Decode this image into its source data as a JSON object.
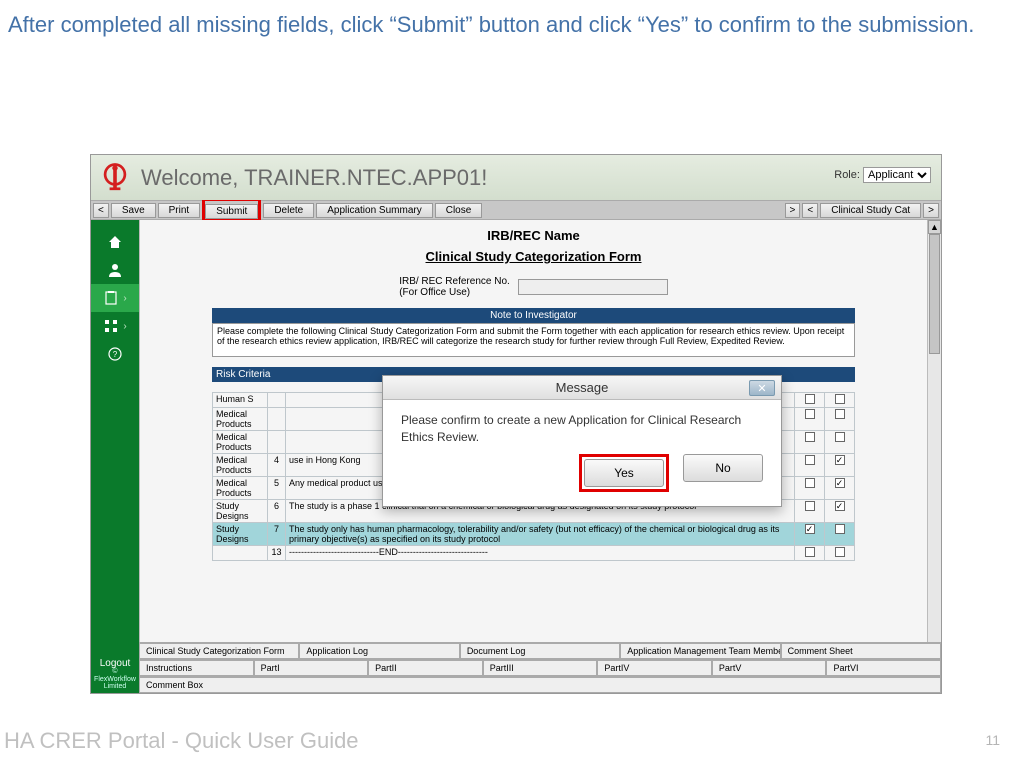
{
  "slide": {
    "title": "After completed all missing fields, click “Submit” button and click “Yes” to confirm to the submission.",
    "footer_left": "HA CRER Portal - Quick User Guide",
    "page_number": "11"
  },
  "header": {
    "welcome": "Welcome, TRAINER.NTEC.APP01!",
    "role_label": "Role:",
    "role_value": "Applicant"
  },
  "toolbar": {
    "nav_prev": "<",
    "save": "Save",
    "print": "Print",
    "submit": "Submit",
    "delete": "Delete",
    "app_summary": "Application Summary",
    "close": "Close",
    "nav_next": ">",
    "breadcrumb": "Clinical Study Cat",
    "breadcrumb_prev": "<",
    "breadcrumb_next": ">"
  },
  "sidebar": {
    "logout": "Logout",
    "copyright": "© FlexWorkflow Limited"
  },
  "form": {
    "heading": "IRB/REC Name",
    "subhead": "Clinical Study Categorization Form",
    "refno_label": "IRB/ REC Reference No.\n(For Office Use)",
    "note_bar": "Note to Investigator",
    "note_text": "Please complete the following Clinical Study Categorization Form and submit the Form together with each application for research ethics review.  Upon receipt of the research ethics review application, IRB/REC will categorize the research study for further review through Full Review, Expedited Review.",
    "risk_header": "Risk Criteria"
  },
  "risk_rows": [
    {
      "cat": "Human S",
      "num": "",
      "desc": "",
      "c1": "",
      "c2": ""
    },
    {
      "cat": "Medical Products",
      "num": "",
      "desc": "",
      "c1": "",
      "c2": ""
    },
    {
      "cat": "Medical Products",
      "num": "",
      "desc": "",
      "c1": "",
      "c2": ""
    },
    {
      "cat": "Medical Products",
      "num": "4",
      "desc": "use in Hong Kong",
      "c1": "",
      "c2": "✓"
    },
    {
      "cat": "Medical Products",
      "num": "5",
      "desc": "Any medical product used is a chemical or biological drug that is to be tested in humans for the first time",
      "c1": "",
      "c2": "✓"
    },
    {
      "cat": "Study Designs",
      "num": "6",
      "desc": "The study is a phase 1 clinical trial on a chemical or biological drug as designated on its study protocol",
      "c1": "",
      "c2": "✓"
    },
    {
      "cat": "Study Designs",
      "num": "7",
      "desc": "The study only has human pharmacology, tolerability and/or safety (but not efficacy) of the chemical or biological drug as its primary objective(s) as specified on its study protocol",
      "c1": "✓",
      "c2": "",
      "hl": true
    },
    {
      "cat": "",
      "num": "13",
      "desc": "------------------------------END------------------------------",
      "c1": "",
      "c2": ""
    }
  ],
  "tabs": {
    "row1": [
      "Clinical Study Categorization Form",
      "Application Log",
      "Document Log",
      "Application Management Team Member Form",
      "Comment Sheet"
    ],
    "row2": [
      "Instructions",
      "PartI",
      "PartII",
      "PartIII",
      "PartIV",
      "PartV",
      "PartVI"
    ],
    "row3": [
      "Comment Box"
    ]
  },
  "modal": {
    "title": "Message",
    "body": "Please confirm to create a new Application for Clinical Research Ethics Review.",
    "yes": "Yes",
    "no": "No"
  }
}
